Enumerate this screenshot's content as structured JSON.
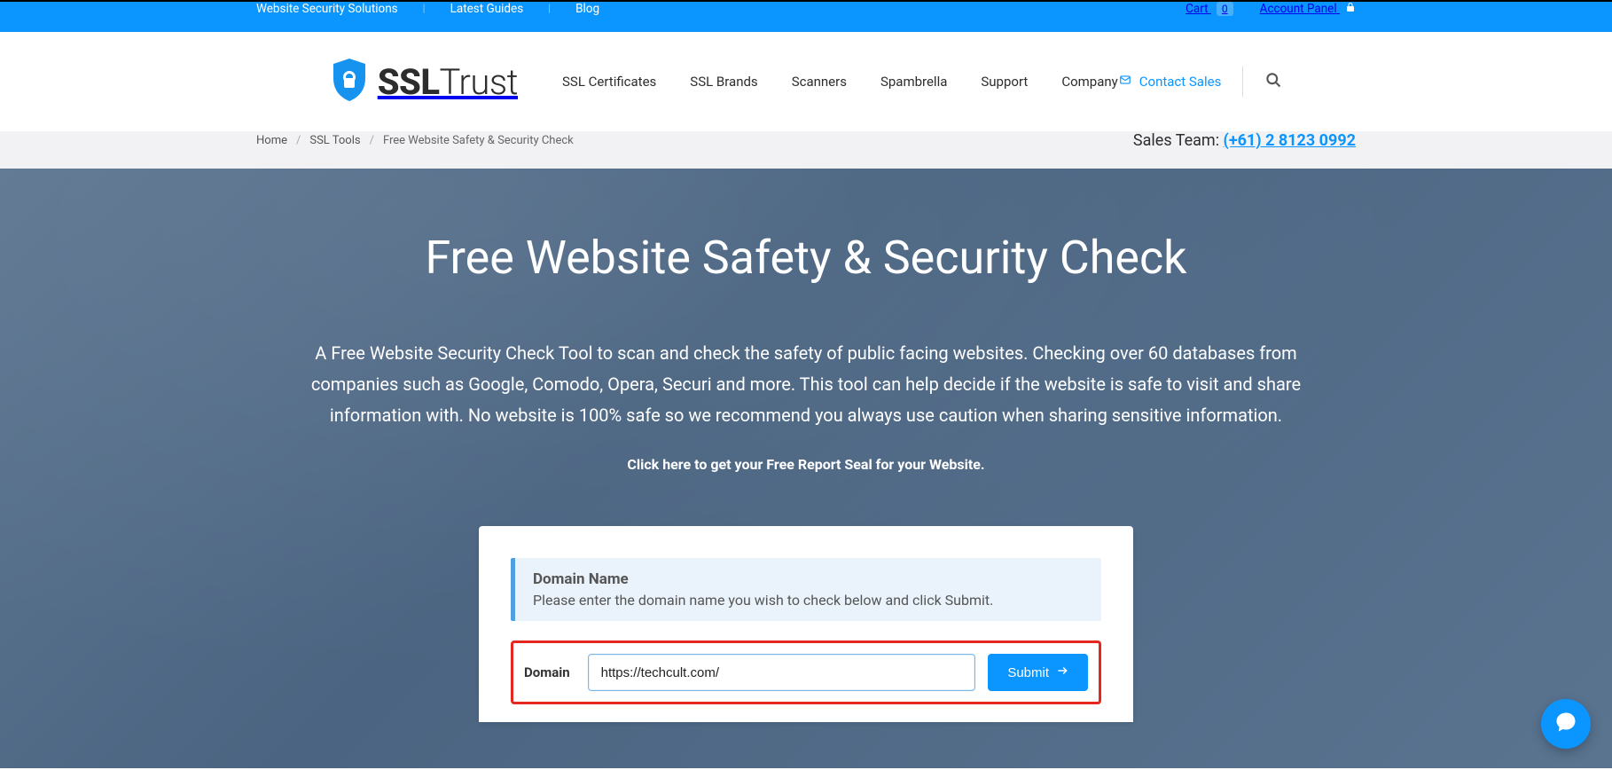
{
  "topbar": {
    "left_links": [
      {
        "label": "Website Security Solutions"
      },
      {
        "label": "Latest Guides"
      },
      {
        "label": "Blog"
      }
    ],
    "cart_label": "Cart",
    "cart_count": "0",
    "account_label": "Account Panel"
  },
  "header": {
    "logo_bold": "SSL",
    "logo_thin": "Trust",
    "nav": [
      {
        "label": "SSL Certificates"
      },
      {
        "label": "SSL Brands"
      },
      {
        "label": "Scanners"
      },
      {
        "label": "Spambrella"
      },
      {
        "label": "Support"
      },
      {
        "label": "Company"
      }
    ],
    "contact_sales": "Contact Sales"
  },
  "breadcrumb": {
    "items": [
      {
        "label": "Home"
      },
      {
        "label": "SSL Tools"
      },
      {
        "label": "Free Website Safety & Security Check"
      }
    ],
    "sales_label": "Sales Team: ",
    "phone": "(+61) 2 8123 0992"
  },
  "hero": {
    "title": "Free Website Safety & Security Check",
    "description": "A Free Website Security Check Tool to scan and check the safety of public facing websites. Checking over 60 databases from companies such as Google, Comodo, Opera, Securi and more. This tool can help decide if the website is safe to visit and share information with. No website is 100% safe so we recommend you always use caution when sharing sensitive information.",
    "seal_text": "Click here to get your Free Report Seal for your Website."
  },
  "form": {
    "info_title": "Domain Name",
    "info_text": "Please enter the domain name you wish to check below and click Submit.",
    "label": "Domain",
    "value": "https://techcult.com/",
    "submit": "Submit"
  },
  "colors": {
    "accent": "#0a95ff"
  }
}
